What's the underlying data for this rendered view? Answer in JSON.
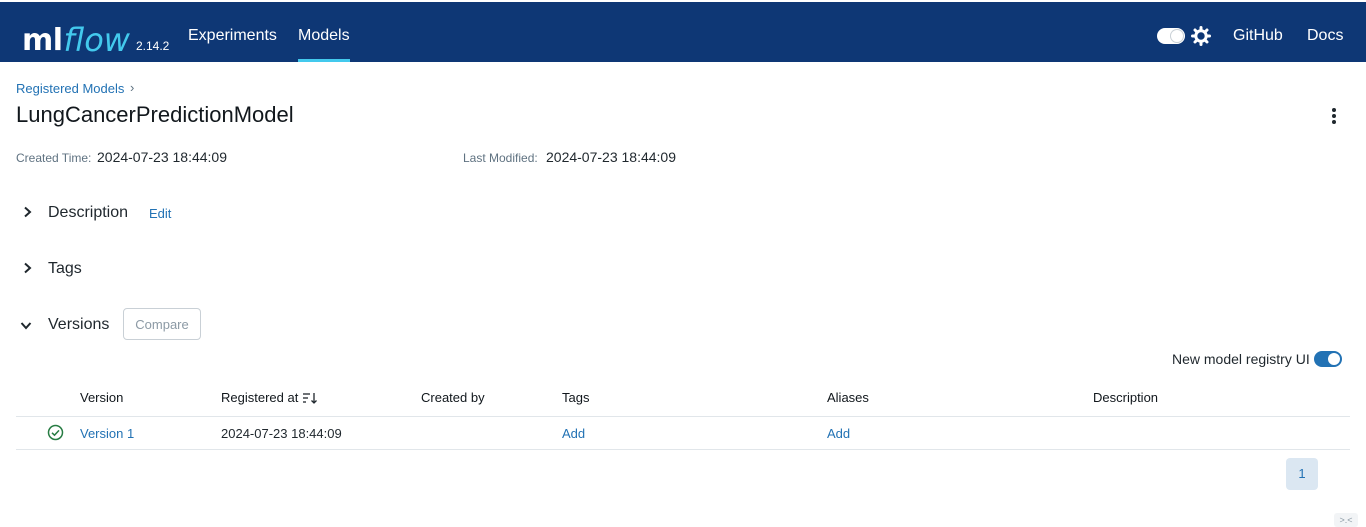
{
  "header": {
    "logo_ml": "ml",
    "logo_flow": "flow",
    "version": "2.14.2",
    "nav": {
      "experiments": "Experiments",
      "models": "Models",
      "github": "GitHub",
      "docs": "Docs"
    },
    "active_nav": "Models",
    "theme_toggle_icon": "toggle-icon",
    "settings_icon": "gear-icon"
  },
  "breadcrumb": {
    "parent": "Registered Models",
    "separator": "›"
  },
  "page": {
    "title": "LungCancerPredictionModel",
    "created_label": "Created Time:",
    "created_value": "2024-07-23 18:44:09",
    "modified_label": "Last Modified:",
    "modified_value": "2024-07-23 18:44:09"
  },
  "sections": {
    "description": {
      "label": "Description",
      "edit": "Edit",
      "expanded": false
    },
    "tags": {
      "label": "Tags",
      "expanded": false
    },
    "versions": {
      "label": "Versions",
      "compare": "Compare",
      "expanded": true
    }
  },
  "registry_toggle": {
    "label": "New model registry UI",
    "on": true
  },
  "table": {
    "columns": [
      "Version",
      "Registered at",
      "Created by",
      "Tags",
      "Aliases",
      "Description"
    ],
    "rows": [
      {
        "status_icon": "check-circle-icon",
        "version": "Version 1",
        "registered_at": "2024-07-23 18:44:09",
        "created_by": "",
        "tags": "Add",
        "aliases": "Add",
        "description": ""
      }
    ]
  },
  "pagination": {
    "current": "1"
  },
  "colors": {
    "header_bg": "#0e3775",
    "accent": "#43c9ed",
    "link": "#2272b4",
    "success": "#277c43"
  }
}
